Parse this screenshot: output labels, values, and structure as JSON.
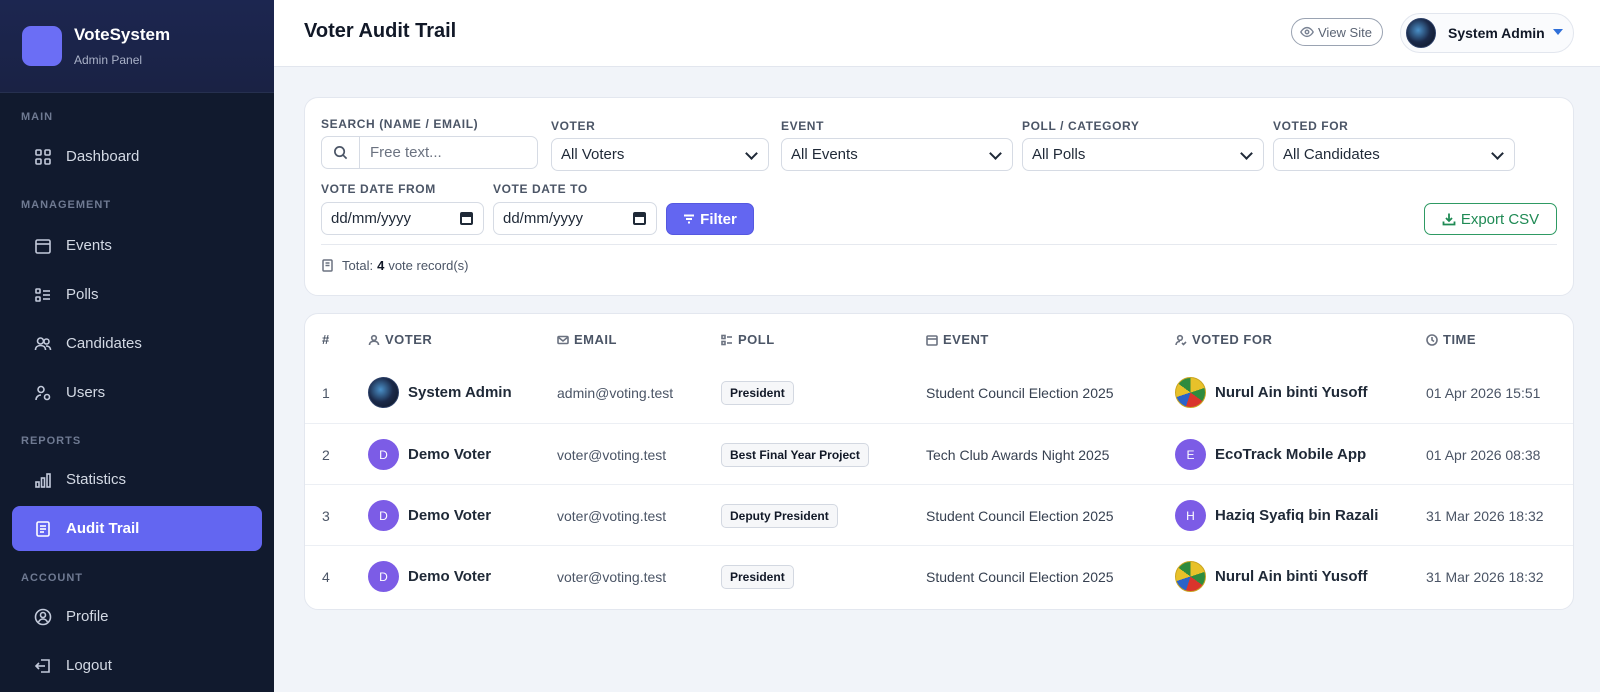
{
  "brand": {
    "name": "VoteSystem",
    "subtitle": "Admin Panel"
  },
  "sidebar": {
    "sections": {
      "main": "MAIN",
      "management": "MANAGEMENT",
      "reports": "REPORTS",
      "account": "ACCOUNT"
    },
    "items": [
      {
        "label": "Dashboard",
        "icon": "grid-icon"
      },
      {
        "label": "Events",
        "icon": "calendar-icon"
      },
      {
        "label": "Polls",
        "icon": "list-check-icon"
      },
      {
        "label": "Candidates",
        "icon": "people-icon"
      },
      {
        "label": "Users",
        "icon": "user-gear-icon"
      },
      {
        "label": "Statistics",
        "icon": "bar-chart-icon"
      },
      {
        "label": "Audit Trail",
        "icon": "journal-icon",
        "active": true
      },
      {
        "label": "Profile",
        "icon": "person-circle-icon"
      },
      {
        "label": "Logout",
        "icon": "logout-icon"
      }
    ]
  },
  "header": {
    "title": "Voter Audit Trail",
    "view_site": "View Site",
    "user_name": "System Admin"
  },
  "filters": {
    "search_label": "SEARCH (NAME / EMAIL)",
    "search_placeholder": "Free text...",
    "voter_label": "VOTER",
    "voter_value": "All Voters",
    "event_label": "EVENT",
    "event_value": "All Events",
    "poll_label": "POLL / CATEGORY",
    "poll_value": "All Polls",
    "voted_for_label": "VOTED FOR",
    "voted_for_value": "All Candidates",
    "date_from_label": "VOTE DATE FROM",
    "date_from_value": "dd/mm/yyyy",
    "date_to_label": "VOTE DATE TO",
    "date_to_value": "dd/mm/yyyy",
    "filter_button": "Filter",
    "export_button": "Export CSV",
    "total_prefix": "Total:",
    "total_count": "4",
    "total_suffix": "vote record(s)"
  },
  "table": {
    "headers": {
      "num": "#",
      "voter": "VOTER",
      "email": "EMAIL",
      "poll": "POLL",
      "event": "EVENT",
      "voted_for": "VOTED FOR",
      "time": "TIME"
    },
    "rows": [
      {
        "num": "1",
        "voter": "System Admin",
        "voter_initial": "",
        "email": "admin@voting.test",
        "poll": "President",
        "event": "Student Council Election 2025",
        "voted_for": "Nurul Ain binti Yusoff",
        "cand_initial": "",
        "time": "01 Apr 2026 15:51"
      },
      {
        "num": "2",
        "voter": "Demo Voter",
        "voter_initial": "D",
        "email": "voter@voting.test",
        "poll": "Best Final Year Project",
        "event": "Tech Club Awards Night 2025",
        "voted_for": "EcoTrack Mobile App",
        "cand_initial": "E",
        "time": "01 Apr 2026 08:38"
      },
      {
        "num": "3",
        "voter": "Demo Voter",
        "voter_initial": "D",
        "email": "voter@voting.test",
        "poll": "Deputy President",
        "event": "Student Council Election 2025",
        "voted_for": "Haziq Syafiq bin Razali",
        "cand_initial": "H",
        "time": "31 Mar 2026 18:32"
      },
      {
        "num": "4",
        "voter": "Demo Voter",
        "voter_initial": "D",
        "email": "voter@voting.test",
        "poll": "President",
        "event": "Student Council Election 2025",
        "voted_for": "Nurul Ain binti Yusoff",
        "cand_initial": "",
        "time": "31 Mar 2026 18:32"
      }
    ]
  },
  "colors": {
    "accent": "#6366f1",
    "sidebar_bg": "#111a2e",
    "export": "#1f8a54"
  }
}
